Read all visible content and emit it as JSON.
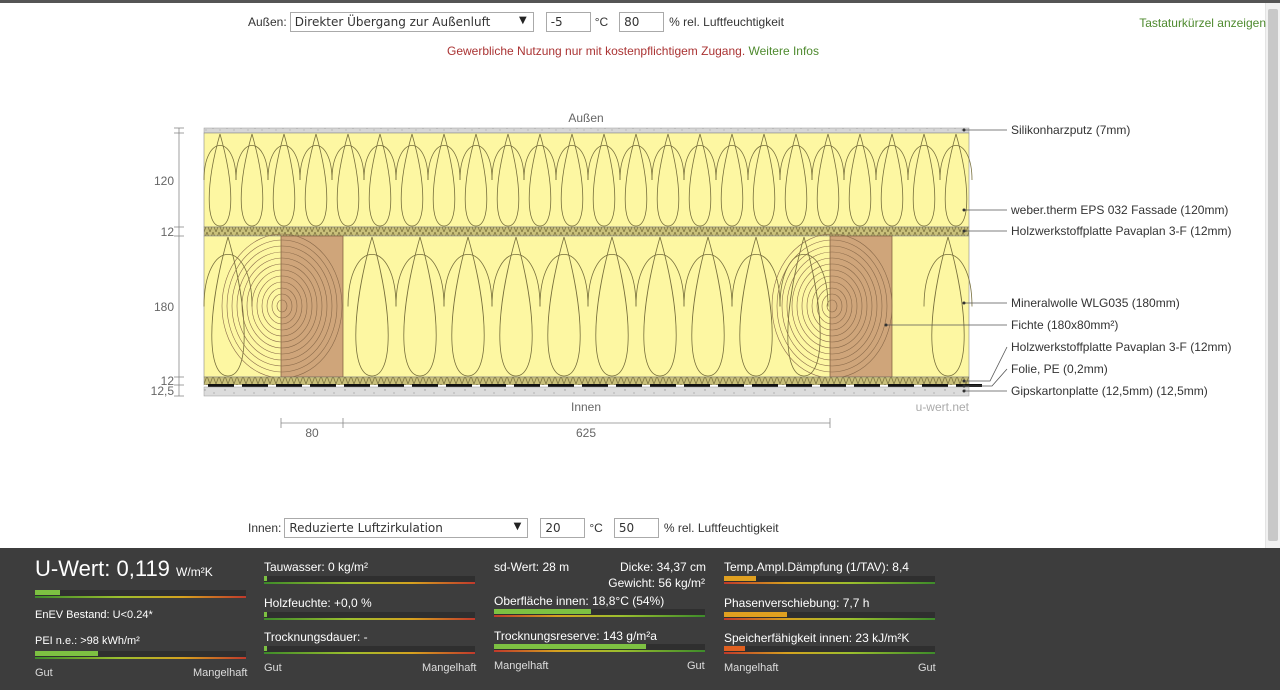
{
  "outside": {
    "label": "Außen:",
    "condition": "Direkter Übergang zur Außenluft",
    "temperature": "-5",
    "temp_unit": "°C",
    "humidity": "80",
    "humidity_unit": "% rel. Luftfeuchtigkeit"
  },
  "inside": {
    "label": "Innen:",
    "condition": "Reduzierte Luftzirkulation",
    "temperature": "20",
    "temp_unit": "°C",
    "humidity": "50",
    "humidity_unit": "% rel. Luftfeuchtigkeit"
  },
  "shortcut_link": "Tastaturkürzel anzeigen",
  "notice": {
    "text": "Gewerbliche Nutzung nur mit kostenpflichtigem Zugang.",
    "link": "Weitere Infos"
  },
  "diagram": {
    "side_top": "Außen",
    "side_bottom": "Innen",
    "watermark": "u-wert.net",
    "thickness_labels": [
      "120",
      "12",
      "180",
      "12",
      "12,5"
    ],
    "spacing_labels": [
      "80",
      "625"
    ],
    "layers": [
      "Silikonharzputz (7mm)",
      "weber.therm EPS 032 Fassade (120mm)",
      "Holzwerkstoffplatte Pavaplan 3-F (12mm)",
      "Mineralwolle WLG035 (180mm)",
      "Fichte (180x80mm²)",
      "Holzwerkstoffplatte Pavaplan 3-F (12mm)",
      "Folie, PE (0,2mm)",
      "Gipskartonplatte (12,5mm) (12,5mm)"
    ],
    "colors": {
      "insulation": "#fdf7a2",
      "wood": "#cfa57a",
      "board": "#b9b06a",
      "plaster": "#d8d8d8"
    }
  },
  "results": {
    "uwert_label": "U-Wert:",
    "uwert_value": "0,119",
    "uwert_unit": "W/m²K",
    "enev": "EnEV Bestand: U<0.24*",
    "pei": "PEI n.e.: >98 kWh/m²",
    "tauwasser": "Tauwasser: 0 kg/m²",
    "holzfeuchte": "Holzfeuchte: +0,0 %",
    "trocknungsdauer": "Trocknungsdauer: -",
    "sd_wert": "sd-Wert: 28 m",
    "dicke": "Dicke: 34,37 cm",
    "gewicht": "Gewicht: 56 kg/m²",
    "oberflaeche": "Oberfläche innen: 18,8°C (54%)",
    "trocknungsreserve": "Trocknungsreserve: 143 g/m²a",
    "temp_ampl": "Temp.Ampl.Dämpfung (1/TAV): 8,4",
    "phasen": "Phasenverschiebung: 7,7 h",
    "speicher": "Speicherfähigkeit innen: 23 kJ/m²K",
    "gut": "Gut",
    "mangelhaft": "Mangelhaft",
    "bars": {
      "uwert": 0.12,
      "pei": 0.3,
      "tauwasser": 0.0,
      "holzfeuchte": 0.0,
      "trocknungsdauer": 0.0,
      "oberflaeche": 0.46,
      "trocknungsreserve": 0.72,
      "temp_ampl": 0.15,
      "phasen": 0.3,
      "speicher": 0.1
    },
    "bar_colors": {
      "good": "#7dc142",
      "warn": "#e0a020",
      "bad": "#e06020"
    }
  }
}
